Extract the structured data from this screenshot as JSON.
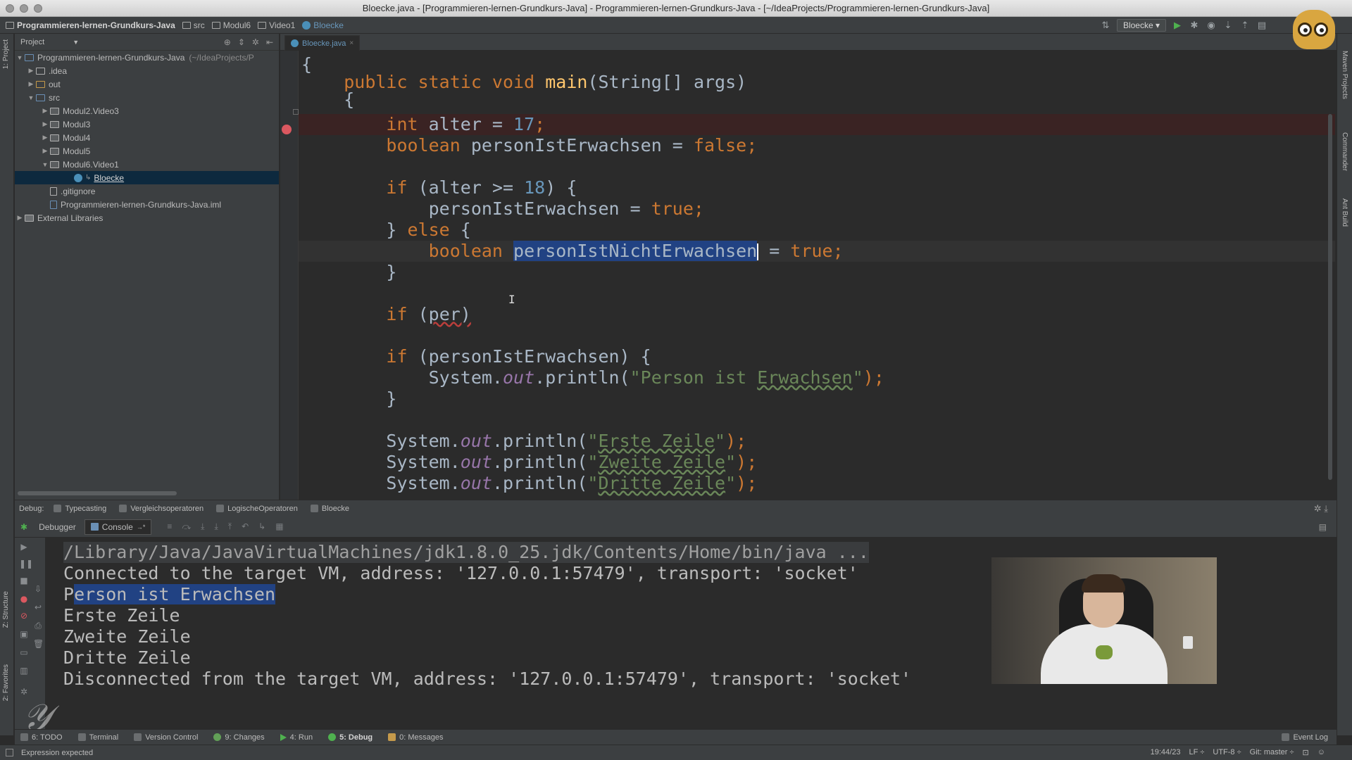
{
  "window": {
    "title": "Bloecke.java - [Programmieren-lernen-Grundkurs-Java] - Programmieren-lernen-Grundkurs-Java - [~/IdeaProjects/Programmieren-lernen-Grundkurs-Java]"
  },
  "navbar": {
    "crumbs": [
      "Programmieren-lernen-Grundkurs-Java",
      "src",
      "Modul6",
      "Video1",
      "Bloecke"
    ],
    "run_config": "Bloecke"
  },
  "left_strip": {
    "project_tab": "1: Project",
    "structure_tab": "Z: Structure",
    "favorites_tab": "2: Favorites"
  },
  "right_strip": {
    "maven_tab": "Maven Projects",
    "commander_tab": "Commander",
    "ant_tab": "Ant Build"
  },
  "project": {
    "header": "Project",
    "tree": [
      {
        "label": "Programmieren-lernen-Grundkurs-Java",
        "hint": "(~/IdeaProjects/P",
        "arrow": "▼"
      },
      {
        "label": ".idea",
        "arrow": "▶"
      },
      {
        "label": "out",
        "arrow": "▶"
      },
      {
        "label": "src",
        "arrow": "▼"
      },
      {
        "label": "Modul2.Video3",
        "arrow": "▶"
      },
      {
        "label": "Modul3",
        "arrow": "▶"
      },
      {
        "label": "Modul4",
        "arrow": "▶"
      },
      {
        "label": "Modul5",
        "arrow": "▶"
      },
      {
        "label": "Modul6.Video1",
        "arrow": "▼"
      },
      {
        "label": "Bloecke"
      },
      {
        "label": ".gitignore"
      },
      {
        "label": "Programmieren-lernen-Grundkurs-Java.iml"
      },
      {
        "label": "External Libraries",
        "arrow": "▶"
      }
    ]
  },
  "editor": {
    "tab": "Bloecke.java",
    "lines": {
      "l1": "{",
      "l2_kw": "public static void",
      "l2_fn": "main",
      "l2_rest": "(String[] args)",
      "l3": "{",
      "l4_kw": "int",
      "l4_a": " alter = ",
      "l4_num": "17",
      "l4_b": ";",
      "l5_kw": "boolean",
      "l5_a": " personIstErwachsen = ",
      "l5_kw2": "false",
      "l5_b": ";",
      "l7_kw": "if",
      "l7_a": " (alter >= ",
      "l7_num": "18",
      "l7_b": ") {",
      "l8_a": "personIstErwachsen = ",
      "l8_kw": "true",
      "l8_b": ";",
      "l9_a": "} ",
      "l9_kw": "else",
      "l9_b": " {",
      "l10_kw": "boolean",
      "l10_sel": "personIstNichtErwachsen",
      "l10_a": " = ",
      "l10_kw2": "true",
      "l10_b": ";",
      "l11": "}",
      "l13_kw": "if",
      "l13_a": " (",
      "l13_err": "per)",
      "l15_kw": "if",
      "l15_a": " (personIstErwachsen) {",
      "l16_a": "System.",
      "l16_out": "out",
      "l16_b": ".println(",
      "l16_str1": "\"Person ist ",
      "l16_str2": "Erwachsen",
      "l16_str3": "\"",
      "l16_c": ");",
      "l17": "}",
      "l19_a": "System.",
      "l19_out": "out",
      "l19_b": ".println(",
      "l19_q1": "\"",
      "l19_str": "Erste Zeile",
      "l19_q2": "\"",
      "l19_c": ");",
      "l20_a": "System.",
      "l20_out": "out",
      "l20_b": ".println(",
      "l20_q1": "\"",
      "l20_str": "Zweite Zeile",
      "l20_q2": "\"",
      "l20_c": ");",
      "l21_a": "System.",
      "l21_out": "out",
      "l21_b": ".println(",
      "l21_q1": "\"",
      "l21_str": "Dritte Zeile",
      "l21_q2": "\"",
      "l21_c": ");"
    }
  },
  "debug": {
    "label": "Debug:",
    "tabs": [
      "Typecasting",
      "Vergleichsoperatoren",
      "LogischeOperatoren",
      "Bloecke"
    ],
    "subtabs": {
      "debugger": "Debugger",
      "console": "Console"
    },
    "console": {
      "line1": "/Library/Java/JavaVirtualMachines/jdk1.8.0_25.jdk/Contents/Home/bin/java ...",
      "line2": "Connected to the target VM, address: '127.0.0.1:57479', transport: 'socket'",
      "line3_pre": "P",
      "line3_sel": "erson ist Erwachsen",
      "line4": "Erste Zeile",
      "line5": "Zweite Zeile",
      "line6": "Dritte Zeile",
      "line7": "Disconnected from the target VM, address: '127.0.0.1:57479', transport: 'socket'"
    }
  },
  "bottom_tools": {
    "todo": "6: TODO",
    "terminal": "Terminal",
    "vcs": "Version Control",
    "changes": "9: Changes",
    "run": "4: Run",
    "debug": "5: Debug",
    "messages": "0: Messages",
    "event_log": "Event Log"
  },
  "status": {
    "message": "Expression expected",
    "position": "19:44/23",
    "line_sep": "LF ÷",
    "encoding": "UTF-8 ÷",
    "git": "Git: master ÷"
  }
}
